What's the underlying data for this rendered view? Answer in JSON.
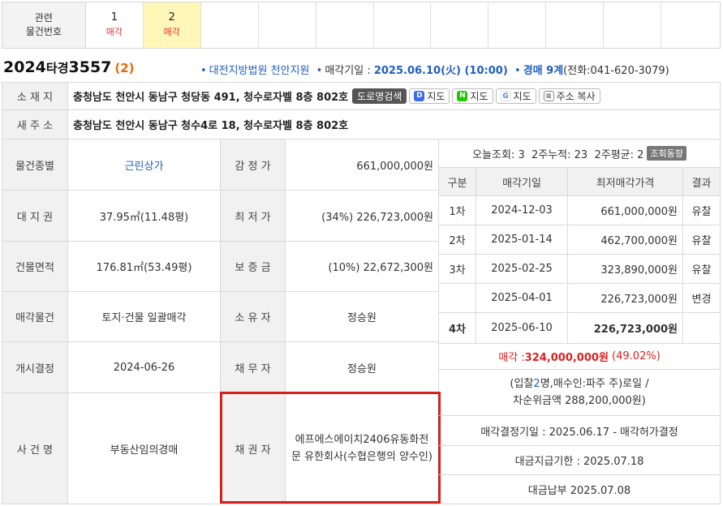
{
  "related": {
    "header": [
      "관련",
      "물건번호"
    ],
    "items": [
      {
        "num": "1",
        "label": "매각"
      },
      {
        "num": "2",
        "label": "매각"
      }
    ]
  },
  "case": {
    "year": "2024",
    "kind": "타경",
    "number": "3557",
    "count": "(2)",
    "court": "대전지방법원 천안지원",
    "sale_label": "매각기일 : ",
    "sale_date": "2025.06.10(火) (10:00)",
    "dept": "경매 9계",
    "phone": "(전화:041-620-3079)"
  },
  "address": {
    "label": "소 재 지",
    "value": "충청남도 천안시 동남구 청당동 491, 청수로자벨 8층 802호",
    "btn_road": "도로명검색",
    "btn_map1": "지도",
    "btn_map2": "지도",
    "btn_map3": "지도",
    "btn_copy": "주소 복사"
  },
  "new_address": {
    "label": "새 주 소",
    "value": "충청남도 천안시 동남구 청수4로 18, 청수로자벨 8층 802호"
  },
  "details": [
    {
      "l1": "물건종별",
      "v1": "근린상가",
      "l2": "감 정 가",
      "v2": "661,000,000원"
    },
    {
      "l1": "대 지 권",
      "v1": "37.95㎡(11.48평)",
      "l2": "최 저 가",
      "v2": "(34%) 226,723,000원"
    },
    {
      "l1": "건물면적",
      "v1": "176.81㎡(53.49평)",
      "l2": "보 증 금",
      "v2": "(10%) 22,672,300원"
    },
    {
      "l1": "매각물건",
      "v1": "토지·건물 일괄매각",
      "l2": "소 유 자",
      "v2": "정승원"
    },
    {
      "l1": "개시결정",
      "v1": "2024-06-26",
      "l2": "채 무 자",
      "v2": "정승원"
    },
    {
      "l1": "사 건 명",
      "v1": "부동산임의경매",
      "l2": "채 권 자",
      "v2": "에프에스에이치2406유동화전문 유한회사(수협은행의 양수인)"
    }
  ],
  "views": {
    "today": "오늘조회: 3",
    "two_week_total": "2주누적: 23",
    "two_week_avg": "2주평균: 2",
    "btn": "조회동향"
  },
  "history": {
    "headers": [
      "구분",
      "매각기일",
      "최저매각가격",
      "결과"
    ],
    "rows": [
      {
        "round": "1차",
        "date": "2024-12-03",
        "price": "661,000,000원",
        "result": "유찰"
      },
      {
        "round": "2차",
        "date": "2025-01-14",
        "price": "462,700,000원",
        "result": "유찰"
      },
      {
        "round": "3차",
        "date": "2025-02-25",
        "price": "323,890,000원",
        "result": "유찰"
      },
      {
        "round": "",
        "date": "2025-04-01",
        "price": "226,723,000원",
        "result": "변경"
      },
      {
        "round": "4차",
        "date": "2025-06-10",
        "price": "226,723,000원",
        "result": ""
      }
    ],
    "sale_label": "매각 : ",
    "sale_price": "324,000,000원",
    "sale_rate": "(49.02%)",
    "bid_info_1a": "(입찰",
    "bid_count": "2",
    "bid_info_1b": "명,매수인:파주 주)로일 /",
    "bid_info_2": "차순위금액 288,200,000원)",
    "decision": "매각결정기일 : 2025.06.17 - 매각허가결정",
    "deadline": "대금지급기한 : 2025.07.18",
    "paid": "대금납부 2025.07.08"
  }
}
